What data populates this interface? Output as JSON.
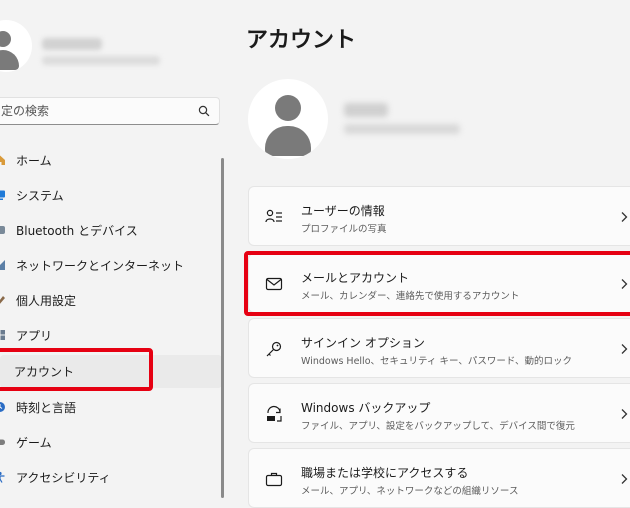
{
  "sidebar": {
    "search": {
      "placeholder": "定の検索"
    },
    "items": [
      {
        "label": "ホーム",
        "icon": "home-icon"
      },
      {
        "label": "システム",
        "icon": "system-icon"
      },
      {
        "label": "Bluetooth とデバイス",
        "icon": "bluetooth-icon"
      },
      {
        "label": "ネットワークとインターネット",
        "icon": "network-icon"
      },
      {
        "label": "個人用設定",
        "icon": "personalization-icon"
      },
      {
        "label": "アプリ",
        "icon": "apps-icon"
      },
      {
        "label": "アカウント",
        "icon": "accounts-icon",
        "active": true
      },
      {
        "label": "時刻と言語",
        "icon": "time-language-icon"
      },
      {
        "label": "ゲーム",
        "icon": "gaming-icon"
      },
      {
        "label": "アクセシビリティ",
        "icon": "accessibility-icon"
      }
    ]
  },
  "main": {
    "title": "アカウント",
    "cards": [
      {
        "title": "ユーザーの情報",
        "subtitle": "プロファイルの写真",
        "icon": "user-info-icon"
      },
      {
        "title": "メールとアカウント",
        "subtitle": "メール、カレンダー、連絡先で使用するアカウント",
        "icon": "mail-icon"
      },
      {
        "title": "サインイン オプション",
        "subtitle": "Windows Hello、セキュリティ キー、パスワード、動的ロック",
        "icon": "key-icon"
      },
      {
        "title": "Windows バックアップ",
        "subtitle": "ファイル、アプリ、設定をバックアップして、デバイス間で復元",
        "icon": "backup-icon"
      },
      {
        "title": "職場または学校にアクセスする",
        "subtitle": "メール、アプリ、ネットワークなどの組織リソース",
        "icon": "briefcase-icon"
      }
    ]
  },
  "colors": {
    "highlight": "#e60012",
    "accent": "#0067c0",
    "background": "#f3f3f3"
  }
}
